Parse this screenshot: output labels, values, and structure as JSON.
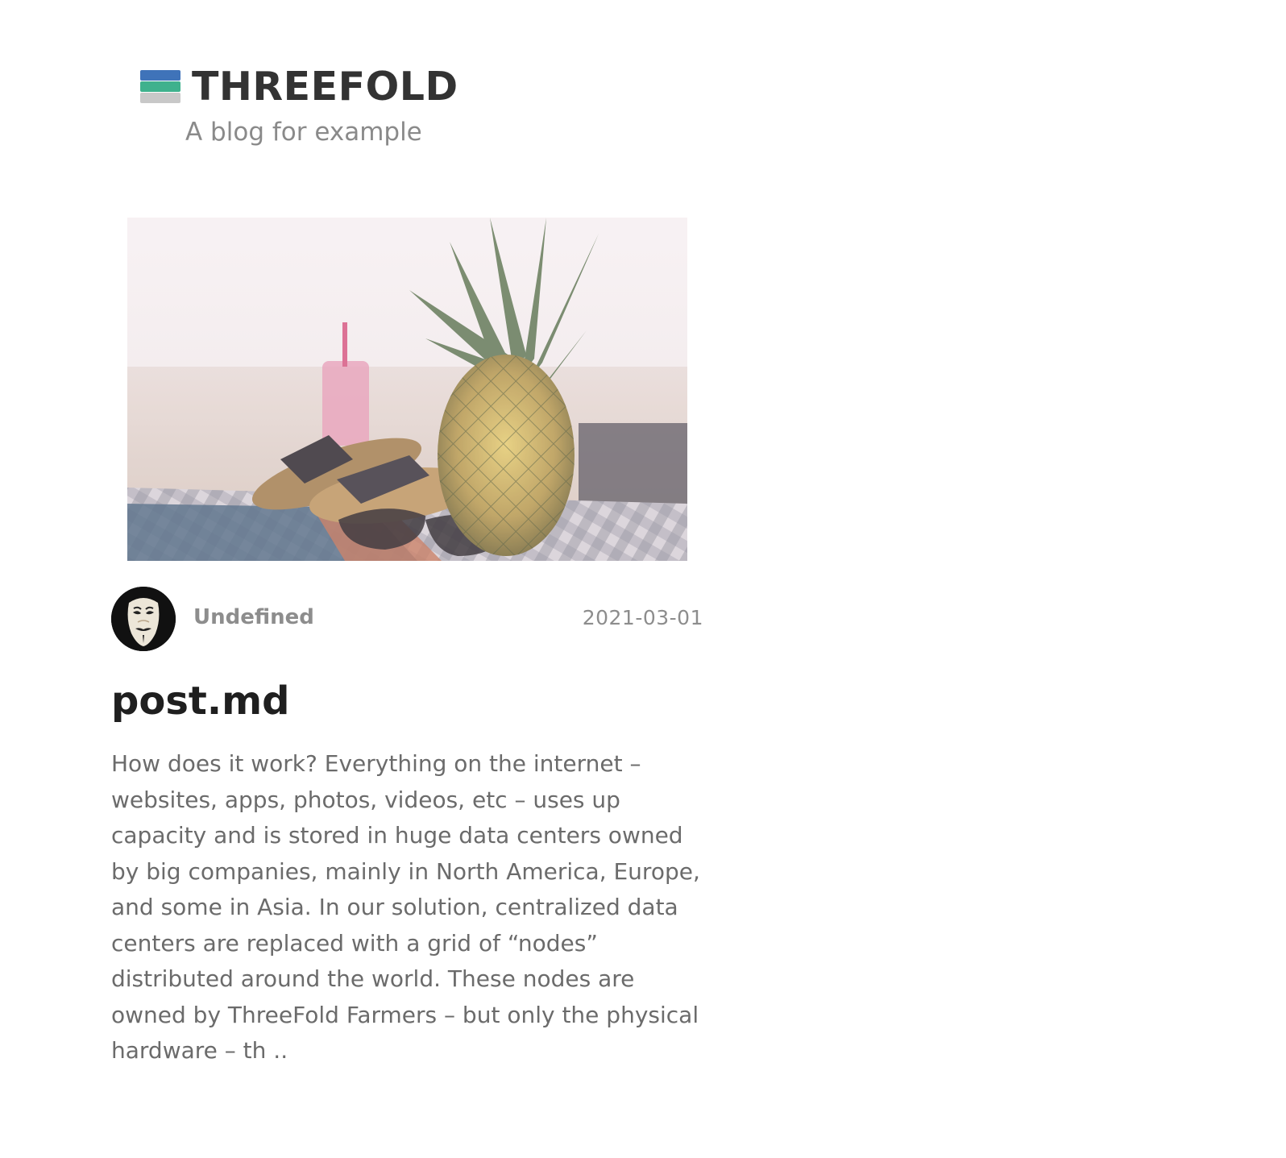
{
  "site": {
    "brand_name": "THREEFOLD",
    "tagline": "A blog for example",
    "logo_colors": [
      "#3f73b9",
      "#3fb18d",
      "#c8c8c8"
    ],
    "logo_text_color": "#333333",
    "tagline_color": "#8a8a8a"
  },
  "post": {
    "image_icon": "pineapple-beach-photo",
    "author_avatar_icon": "masked-face-avatar",
    "author": "Undefined",
    "date": "2021-03-01",
    "title": "post.md",
    "excerpt": "How does it work? Everything on the internet – websites, apps, photos, videos, etc – uses up capacity and is stored in huge data centers owned by big companies, mainly in North America, Europe, and some in Asia. In our solution, centralized data centers are replaced with a grid of “nodes” distributed around the world. These nodes are owned by ThreeFold Farmers – but only the physical hardware – th ..",
    "meta_color": "#8d8d8d",
    "title_color": "#1f1f1f",
    "excerpt_color": "#6b6b6b"
  }
}
